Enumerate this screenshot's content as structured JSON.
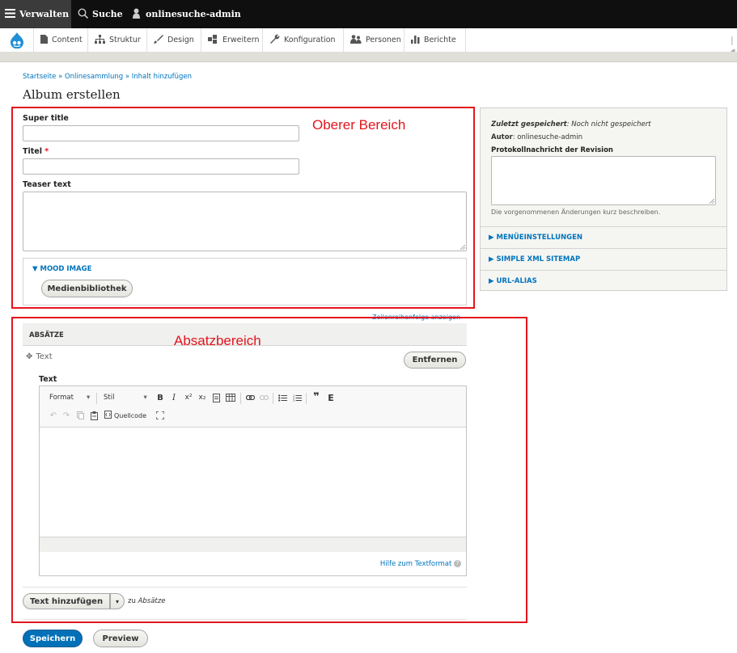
{
  "toolbar": {
    "manage_label": "Verwalten",
    "search_label": "Suche",
    "user_label": "onlinesuche-admin"
  },
  "tray": {
    "items": [
      {
        "label": "Content",
        "icon": "file-icon"
      },
      {
        "label": "Struktur",
        "icon": "sitemap-icon"
      },
      {
        "label": "Design",
        "icon": "paintbrush-icon"
      },
      {
        "label": "Erweitern",
        "icon": "puzzle-icon"
      },
      {
        "label": "Konfiguration",
        "icon": "wrench-icon"
      },
      {
        "label": "Personen",
        "icon": "people-icon"
      },
      {
        "label": "Berichte",
        "icon": "barchart-icon"
      }
    ]
  },
  "breadcrumb": {
    "items": [
      "Startseite",
      "Onlinesammlung",
      "Inhalt hinzufügen"
    ],
    "separator": "»"
  },
  "page": {
    "title": "Album erstellen"
  },
  "form": {
    "super_title_label": "Super title",
    "titel_label": "Titel",
    "required_mark": "*",
    "teaser_label": "Teaser text",
    "mood_image_label": "▼ MOOD IMAGE",
    "media_button": "Medienbibliothek",
    "row_order_link": "Zeilenreihenfolge anzeigen",
    "paragraphs_header": "ABSÄTZE",
    "paragraph_type": "Text",
    "remove_button": "Entfernen",
    "text_label": "Text",
    "format_select": "Format",
    "style_select": "Stil",
    "source_label": "Quellcode",
    "help_link": "Hilfe zum Textformat",
    "add_button": "Text hinzufügen",
    "add_suffix": "zu",
    "add_target": "Absätze",
    "save_button": "Speichern",
    "preview_button": "Preview"
  },
  "sidebar": {
    "last_saved_label": "Zuletzt gespeichert",
    "last_saved_value": ": Noch nicht gespeichert",
    "author_label": "Autor",
    "author_value": ": onlinesuche-admin",
    "revision_label": "Protokollnachricht der Revision",
    "revision_help": "Die vorgenommenen Änderungen kurz beschreiben.",
    "sections": [
      "▶ MENÜEINSTELLUNGEN",
      "▶ SIMPLE XML SITEMAP",
      "▶ URL-ALIAS"
    ]
  },
  "annotations": {
    "upper_area": "Oberer Bereich",
    "paragraph_area": "Absatzbereich"
  },
  "colors": {
    "toolbar_bg": "#0f0f0f",
    "link": "#0074bd",
    "annotation_red": "#e3151d",
    "primary_button": "#0071b8"
  }
}
